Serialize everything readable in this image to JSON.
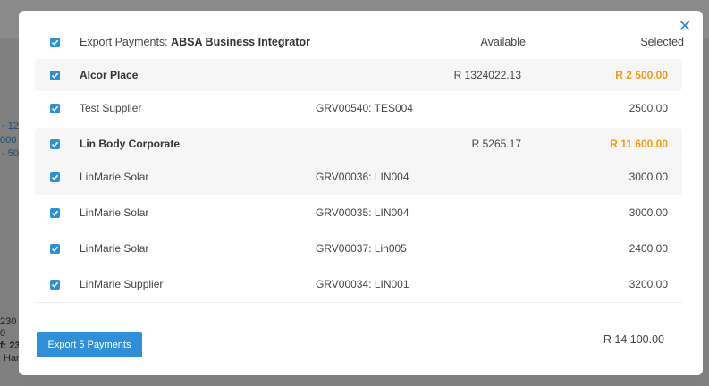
{
  "background": {
    "lines": [
      "- 12",
      "000",
      "- 50",
      "230",
      "0",
      "f: 23",
      "Ham"
    ]
  },
  "modal": {
    "close_icon": "close-icon",
    "header": {
      "title_prefix": "Export Payments: ",
      "title_bold": "ABSA Business Integrator",
      "available_label": "Available",
      "selected_label": "Selected"
    },
    "groups": [
      {
        "name": "Alcor Place",
        "available": "R 1324022.13",
        "selected": "R 2 500.00",
        "items": [
          {
            "name": "Test Supplier",
            "ref": "GRV00540: TES004",
            "amount": "2500.00"
          }
        ]
      },
      {
        "name": "Lin Body Corporate",
        "available": "R 5265.17",
        "selected": "R 11 600.00",
        "items": [
          {
            "name": "LinMarie Solar",
            "ref": "GRV00036: LIN004",
            "amount": "3000.00"
          },
          {
            "name": "LinMarie Solar",
            "ref": "GRV00035: LIN004",
            "amount": "3000.00"
          },
          {
            "name": "LinMarie Solar",
            "ref": "GRV00037: Lin005",
            "amount": "2400.00"
          },
          {
            "name": "LinMarie Supplier",
            "ref": "GRV00034: LIN001",
            "amount": "3200.00"
          }
        ]
      }
    ],
    "footer": {
      "export_button": "Export 5 Payments",
      "total": "R 14 100.00"
    },
    "colors": {
      "accent": "#2d8fd5",
      "selected_amount": "#f29c12"
    }
  }
}
